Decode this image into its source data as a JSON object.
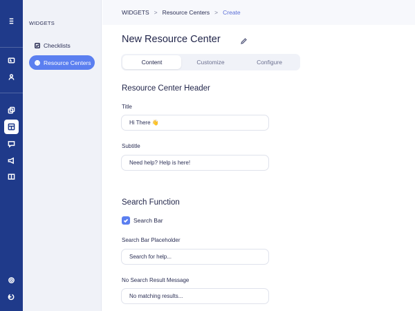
{
  "sidebar": {
    "title": "WIDGETS",
    "items": [
      {
        "label": "Checklists",
        "icon": "checkbox-icon"
      },
      {
        "label": "Resource Centers",
        "icon": "globe-icon"
      }
    ]
  },
  "rail_icons": [
    "logo-icon",
    "id-card-icon",
    "user-icon",
    "copy-icon",
    "layout-icon",
    "message-icon",
    "megaphone-icon",
    "book-icon",
    "settings-icon",
    "logout-icon"
  ],
  "breadcrumb": {
    "root": "WIDGETS",
    "section": "Resource Centers",
    "current": "Create",
    "separator": ">"
  },
  "page": {
    "title": "New Resource Center"
  },
  "tabs": [
    {
      "label": "Content",
      "active": true
    },
    {
      "label": "Customize",
      "active": false
    },
    {
      "label": "Configure",
      "active": false
    }
  ],
  "header_section": {
    "heading": "Resource Center Header",
    "title_label": "Title",
    "title_value": "Hi There 👋",
    "subtitle_label": "Subtitle",
    "subtitle_value": "Need help? Help is here!"
  },
  "search_section": {
    "heading": "Search Function",
    "search_bar_label": "Search Bar",
    "search_bar_checked": true,
    "placeholder_label": "Search Bar Placeholder",
    "placeholder_value": "Search for help...",
    "no_result_label": "No Search Result Message",
    "no_result_value": "No matching results..."
  },
  "colors": {
    "rail": "#1f3a8a",
    "accent": "#5b7ff0",
    "sidebar_bg": "#f0f2f8"
  }
}
